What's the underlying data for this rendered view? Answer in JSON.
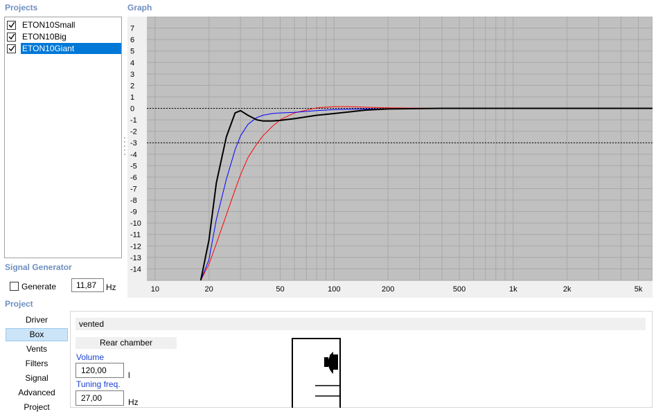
{
  "sections": {
    "projects_title": "Projects",
    "graph_title": "Graph",
    "signal_generator_title": "Signal Generator",
    "project_title": "Project"
  },
  "projects": [
    {
      "label": "ETON10Small",
      "checked": true,
      "selected": false
    },
    {
      "label": "ETON10Big",
      "checked": true,
      "selected": false
    },
    {
      "label": "ETON10Giant",
      "checked": true,
      "selected": true
    }
  ],
  "signal_generator": {
    "generate_label": "Generate",
    "generate_checked": false,
    "frequency_value": "11,87",
    "frequency_unit": "Hz"
  },
  "graph": {
    "y_ticks": [
      "7",
      "6",
      "5",
      "4",
      "3",
      "2",
      "1",
      "0",
      "-1",
      "-2",
      "-3",
      "-4",
      "-5",
      "-6",
      "-7",
      "-8",
      "-9",
      "-10",
      "-11",
      "-12",
      "-13",
      "-14"
    ],
    "x_ticks": [
      "10",
      "20",
      "50",
      "100",
      "200",
      "500",
      "1k",
      "2k",
      "5k"
    ],
    "colors": {
      "background": "#c0c0c0",
      "grid": "#a8a8a8",
      "black_curve": "#000000",
      "blue_curve": "#0000ff",
      "red_curve": "#ff0000"
    }
  },
  "chart_data": {
    "type": "line",
    "x_scale": "log",
    "xlim": [
      9,
      6000
    ],
    "ylim": [
      -15,
      8
    ],
    "reference_lines": [
      0,
      -3
    ],
    "grid": true,
    "series": [
      {
        "color": "#000000",
        "x": [
          18,
          20,
          22,
          25,
          28,
          30,
          33,
          37,
          40,
          45,
          50,
          60,
          80,
          100,
          150,
          200,
          400,
          6000
        ],
        "y": [
          -15,
          -11.5,
          -6.5,
          -2.5,
          -0.4,
          -0.2,
          -0.6,
          -1.0,
          -1.1,
          -1.1,
          -1.05,
          -0.9,
          -0.6,
          -0.45,
          -0.15,
          -0.05,
          0,
          0
        ]
      },
      {
        "color": "#0000ff",
        "x": [
          18,
          20,
          22,
          25,
          28,
          30,
          33,
          37,
          40,
          45,
          50,
          60,
          80,
          100,
          150,
          200,
          400
        ],
        "y": [
          -15,
          -13.2,
          -9.7,
          -6.2,
          -3.6,
          -2.4,
          -1.4,
          -0.8,
          -0.6,
          -0.45,
          -0.4,
          -0.35,
          -0.2,
          -0.1,
          -0.05,
          -0.05,
          0
        ]
      },
      {
        "color": "#ff0000",
        "x": [
          18,
          20,
          22,
          25,
          28,
          30,
          33,
          37,
          40,
          45,
          50,
          60,
          80,
          100,
          120,
          150,
          200,
          400
        ],
        "y": [
          -15,
          -13.6,
          -11.8,
          -9.3,
          -7.1,
          -5.8,
          -4.3,
          -3.1,
          -2.4,
          -1.6,
          -1.0,
          -0.4,
          0.05,
          0.15,
          0.15,
          0.1,
          0.05,
          0
        ]
      }
    ]
  },
  "nav": [
    "Driver",
    "Box",
    "Vents",
    "Filters",
    "Signal",
    "Advanced",
    "Project"
  ],
  "nav_active": "Box",
  "box": {
    "type": "vented",
    "rear_chamber": "Rear chamber",
    "volume_label": "Volume",
    "volume_value": "120,00",
    "volume_unit": "l",
    "tuning_label": "Tuning freq.",
    "tuning_value": "27,00",
    "tuning_unit": "Hz"
  }
}
